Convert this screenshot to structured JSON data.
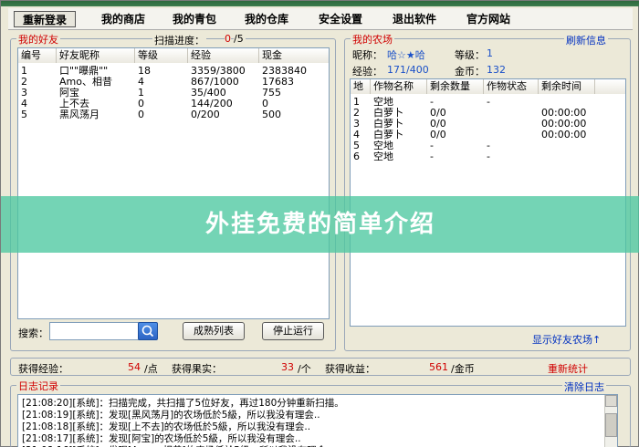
{
  "menu": {
    "items": [
      "重新登录",
      "我的商店",
      "我的青包",
      "我的仓库",
      "安全设置",
      "退出软件",
      "官方网站"
    ]
  },
  "friends": {
    "legend": "我的好友",
    "scan_label": "扫描进度：",
    "scan_current": "0",
    "scan_total": "/5",
    "columns": [
      "编号",
      "好友昵称",
      "等级",
      "经验",
      "现金"
    ],
    "rows": [
      [
        "1",
        "口\"\"曝鼎\"\"",
        "18",
        "3359/3800",
        "2383840"
      ],
      [
        "2",
        "Amo、相昔",
        "4",
        "867/1000",
        "17683"
      ],
      [
        "3",
        "阿宝",
        "1",
        "35/400",
        "755"
      ],
      [
        "4",
        "上不去",
        "0",
        "144/200",
        "0"
      ],
      [
        "5",
        "黑风荡月",
        "0",
        "0/200",
        "500"
      ]
    ],
    "search_label": "搜索：",
    "search_value": "",
    "btn_list": "成熟列表",
    "btn_stop": "停止运行"
  },
  "farm": {
    "legend": "我的农场",
    "refresh_link": "刷新信息",
    "nickname_label": "昵称：",
    "nickname_value": "哈☆★哈",
    "level_label": "等级：",
    "level_value": "1",
    "exp_label": "经验：",
    "exp_value": "171/400",
    "gold_label": "金币：",
    "gold_value": "132",
    "columns": [
      "地",
      "作物名称",
      "剩余数量",
      "作物状态",
      "剩余时间"
    ],
    "rows": [
      [
        "1",
        "空地",
        "-",
        "-",
        ""
      ],
      [
        "2",
        "白萝卜",
        "0/0",
        "",
        "00:00:00"
      ],
      [
        "3",
        "白萝卜",
        "0/0",
        "",
        "00:00:00"
      ],
      [
        "4",
        "白萝卜",
        "0/0",
        "",
        "00:00:00"
      ],
      [
        "5",
        "空地",
        "-",
        "-",
        ""
      ],
      [
        "6",
        "空地",
        "-",
        "-",
        ""
      ]
    ],
    "show_friend_farm": "显示好友农场↑"
  },
  "stats": {
    "exp_label": "获得经验：",
    "exp_value": "54",
    "exp_unit": "/点",
    "fruit_label": "获得果实：",
    "fruit_value": "33",
    "fruit_unit": "/个",
    "income_label": "获得收益：",
    "income_value": "561",
    "income_unit": "/金币",
    "reset_link": "重新统计"
  },
  "log": {
    "legend": "日志记录",
    "clear_link": "清除日志",
    "lines": [
      "[21:08:20][系统]：扫描完成，共扫描了5位好友，再过180分钟重新扫描。",
      "[21:08:19][系统]：发现[黑风荡月]的农场低於5級，所以我没有理会..",
      "[21:08:18][系统]：发现[上不去]的农场低於5級，所以我没有理会..",
      "[21:08:17][系统]：发现[阿宝]的农场低於5級，所以我没有理会..",
      "[21:08:16][系统]：发现[Amo、相昔]的农场低於5級，所以我没有理会.."
    ]
  },
  "overlay": {
    "text": "外挂免费的简单介绍"
  },
  "colors": {
    "accent_red": "#d00000",
    "link_blue": "#0030c0",
    "overlay_green": "#4dc8a0"
  }
}
